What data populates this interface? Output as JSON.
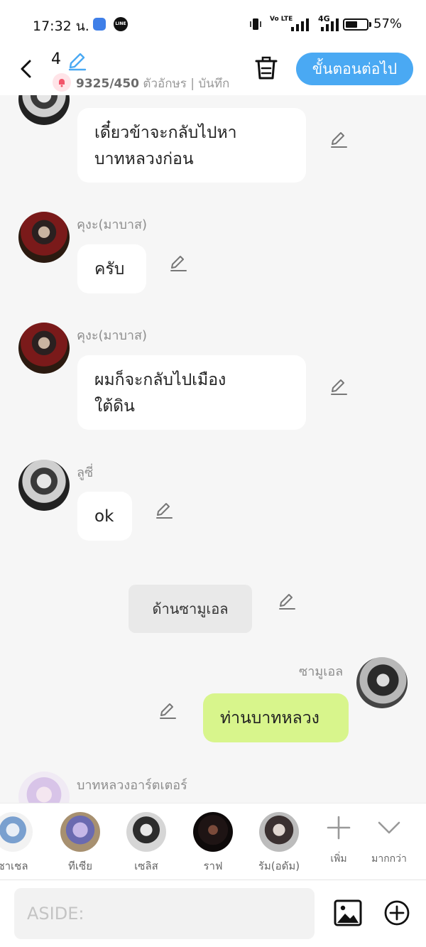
{
  "status_bar": {
    "time": "17:32 น.",
    "volte": "Vo LTE",
    "network": "4G",
    "battery_percent": "57%",
    "battery_level": 0.57,
    "line_label": "LINE"
  },
  "header": {
    "episode_number": "4",
    "char_count": "9325/450",
    "char_label": " ตัวอักษร | บันทึก",
    "next_button": "ขั้นตอนต่อไป"
  },
  "messages": [
    {
      "speaker": "",
      "text_lines": [
        "เดี๋ยวข้าจะกลับไปหา",
        "บาทหลวงก่อน"
      ]
    },
    {
      "speaker": "คุงะ(มาบาส)",
      "text_lines": [
        "ครับ"
      ]
    },
    {
      "speaker": "คุงะ(มาบาส)",
      "text_lines": [
        "ผมก็จะกลับไปเมือง",
        "ใต้ดิน"
      ]
    },
    {
      "speaker": "ลูซี่",
      "text_lines": [
        "ok"
      ]
    },
    {
      "narration": "ด้านซามูเอล"
    },
    {
      "speaker": "ซามูเอล",
      "text_lines": [
        "ท่านบาทหลวง"
      ],
      "mine": true
    },
    {
      "speaker": "บาทหลวงอาร์ตเตอร์"
    }
  ],
  "characters": [
    {
      "name": "ซาเชล"
    },
    {
      "name": "ทีเซีย"
    },
    {
      "name": "เซลิส"
    },
    {
      "name": "ราฟ"
    },
    {
      "name": "รัม(อดัม)"
    }
  ],
  "strip_actions": {
    "add_label": "เพิ่ม",
    "more_label": "มากกว่า"
  },
  "input": {
    "placeholder": "ASIDE:"
  },
  "colors": {
    "accent": "#4aa9f3",
    "my_bubble": "#d8f58c",
    "narration": "#e9e9e9"
  }
}
